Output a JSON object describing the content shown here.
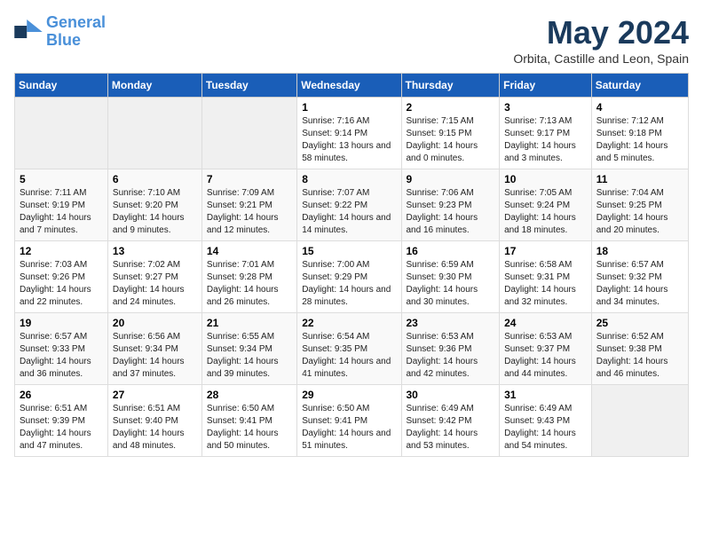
{
  "logo": {
    "line1": "General",
    "line2": "Blue"
  },
  "title": "May 2024",
  "subtitle": "Orbita, Castille and Leon, Spain",
  "days_header": [
    "Sunday",
    "Monday",
    "Tuesday",
    "Wednesday",
    "Thursday",
    "Friday",
    "Saturday"
  ],
  "weeks": [
    [
      {
        "empty": true
      },
      {
        "empty": true
      },
      {
        "empty": true
      },
      {
        "day": "1",
        "sunrise": "Sunrise: 7:16 AM",
        "sunset": "Sunset: 9:14 PM",
        "daylight": "Daylight: 13 hours and 58 minutes."
      },
      {
        "day": "2",
        "sunrise": "Sunrise: 7:15 AM",
        "sunset": "Sunset: 9:15 PM",
        "daylight": "Daylight: 14 hours and 0 minutes."
      },
      {
        "day": "3",
        "sunrise": "Sunrise: 7:13 AM",
        "sunset": "Sunset: 9:17 PM",
        "daylight": "Daylight: 14 hours and 3 minutes."
      },
      {
        "day": "4",
        "sunrise": "Sunrise: 7:12 AM",
        "sunset": "Sunset: 9:18 PM",
        "daylight": "Daylight: 14 hours and 5 minutes."
      }
    ],
    [
      {
        "day": "5",
        "sunrise": "Sunrise: 7:11 AM",
        "sunset": "Sunset: 9:19 PM",
        "daylight": "Daylight: 14 hours and 7 minutes."
      },
      {
        "day": "6",
        "sunrise": "Sunrise: 7:10 AM",
        "sunset": "Sunset: 9:20 PM",
        "daylight": "Daylight: 14 hours and 9 minutes."
      },
      {
        "day": "7",
        "sunrise": "Sunrise: 7:09 AM",
        "sunset": "Sunset: 9:21 PM",
        "daylight": "Daylight: 14 hours and 12 minutes."
      },
      {
        "day": "8",
        "sunrise": "Sunrise: 7:07 AM",
        "sunset": "Sunset: 9:22 PM",
        "daylight": "Daylight: 14 hours and 14 minutes."
      },
      {
        "day": "9",
        "sunrise": "Sunrise: 7:06 AM",
        "sunset": "Sunset: 9:23 PM",
        "daylight": "Daylight: 14 hours and 16 minutes."
      },
      {
        "day": "10",
        "sunrise": "Sunrise: 7:05 AM",
        "sunset": "Sunset: 9:24 PM",
        "daylight": "Daylight: 14 hours and 18 minutes."
      },
      {
        "day": "11",
        "sunrise": "Sunrise: 7:04 AM",
        "sunset": "Sunset: 9:25 PM",
        "daylight": "Daylight: 14 hours and 20 minutes."
      }
    ],
    [
      {
        "day": "12",
        "sunrise": "Sunrise: 7:03 AM",
        "sunset": "Sunset: 9:26 PM",
        "daylight": "Daylight: 14 hours and 22 minutes."
      },
      {
        "day": "13",
        "sunrise": "Sunrise: 7:02 AM",
        "sunset": "Sunset: 9:27 PM",
        "daylight": "Daylight: 14 hours and 24 minutes."
      },
      {
        "day": "14",
        "sunrise": "Sunrise: 7:01 AM",
        "sunset": "Sunset: 9:28 PM",
        "daylight": "Daylight: 14 hours and 26 minutes."
      },
      {
        "day": "15",
        "sunrise": "Sunrise: 7:00 AM",
        "sunset": "Sunset: 9:29 PM",
        "daylight": "Daylight: 14 hours and 28 minutes."
      },
      {
        "day": "16",
        "sunrise": "Sunrise: 6:59 AM",
        "sunset": "Sunset: 9:30 PM",
        "daylight": "Daylight: 14 hours and 30 minutes."
      },
      {
        "day": "17",
        "sunrise": "Sunrise: 6:58 AM",
        "sunset": "Sunset: 9:31 PM",
        "daylight": "Daylight: 14 hours and 32 minutes."
      },
      {
        "day": "18",
        "sunrise": "Sunrise: 6:57 AM",
        "sunset": "Sunset: 9:32 PM",
        "daylight": "Daylight: 14 hours and 34 minutes."
      }
    ],
    [
      {
        "day": "19",
        "sunrise": "Sunrise: 6:57 AM",
        "sunset": "Sunset: 9:33 PM",
        "daylight": "Daylight: 14 hours and 36 minutes."
      },
      {
        "day": "20",
        "sunrise": "Sunrise: 6:56 AM",
        "sunset": "Sunset: 9:34 PM",
        "daylight": "Daylight: 14 hours and 37 minutes."
      },
      {
        "day": "21",
        "sunrise": "Sunrise: 6:55 AM",
        "sunset": "Sunset: 9:34 PM",
        "daylight": "Daylight: 14 hours and 39 minutes."
      },
      {
        "day": "22",
        "sunrise": "Sunrise: 6:54 AM",
        "sunset": "Sunset: 9:35 PM",
        "daylight": "Daylight: 14 hours and 41 minutes."
      },
      {
        "day": "23",
        "sunrise": "Sunrise: 6:53 AM",
        "sunset": "Sunset: 9:36 PM",
        "daylight": "Daylight: 14 hours and 42 minutes."
      },
      {
        "day": "24",
        "sunrise": "Sunrise: 6:53 AM",
        "sunset": "Sunset: 9:37 PM",
        "daylight": "Daylight: 14 hours and 44 minutes."
      },
      {
        "day": "25",
        "sunrise": "Sunrise: 6:52 AM",
        "sunset": "Sunset: 9:38 PM",
        "daylight": "Daylight: 14 hours and 46 minutes."
      }
    ],
    [
      {
        "day": "26",
        "sunrise": "Sunrise: 6:51 AM",
        "sunset": "Sunset: 9:39 PM",
        "daylight": "Daylight: 14 hours and 47 minutes."
      },
      {
        "day": "27",
        "sunrise": "Sunrise: 6:51 AM",
        "sunset": "Sunset: 9:40 PM",
        "daylight": "Daylight: 14 hours and 48 minutes."
      },
      {
        "day": "28",
        "sunrise": "Sunrise: 6:50 AM",
        "sunset": "Sunset: 9:41 PM",
        "daylight": "Daylight: 14 hours and 50 minutes."
      },
      {
        "day": "29",
        "sunrise": "Sunrise: 6:50 AM",
        "sunset": "Sunset: 9:41 PM",
        "daylight": "Daylight: 14 hours and 51 minutes."
      },
      {
        "day": "30",
        "sunrise": "Sunrise: 6:49 AM",
        "sunset": "Sunset: 9:42 PM",
        "daylight": "Daylight: 14 hours and 53 minutes."
      },
      {
        "day": "31",
        "sunrise": "Sunrise: 6:49 AM",
        "sunset": "Sunset: 9:43 PM",
        "daylight": "Daylight: 14 hours and 54 minutes."
      },
      {
        "empty": true
      }
    ]
  ]
}
